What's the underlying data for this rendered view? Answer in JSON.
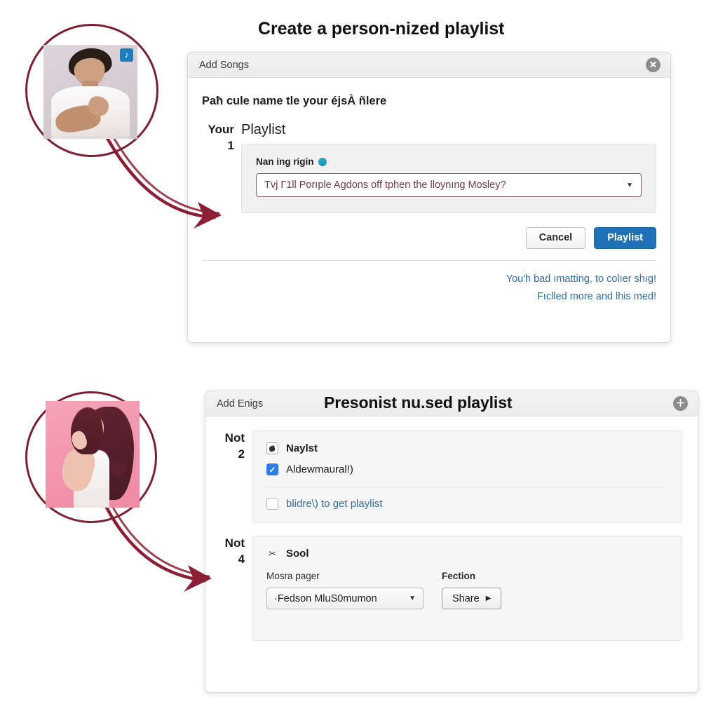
{
  "headings": {
    "top": "Create a person-nized playlist",
    "bottom": "Presonist nu.sed playlist"
  },
  "callouts": [
    {
      "name": "photo-man",
      "badge": "♪"
    },
    {
      "name": "photo-woman",
      "badge": ""
    }
  ],
  "top_dialog": {
    "titlebar": {
      "title": "Add Songs",
      "close_icon": "close-icon",
      "close_glyph": "✕"
    },
    "prompt": "Paħ cule name tle your éjsÀ ñlere",
    "step_tag": {
      "label": "Your",
      "number": "1"
    },
    "section_title": "Playlist",
    "field": {
      "label": "Nan ing rigin",
      "info_icon": "info-icon",
      "selected_value": "Tvј Г1ll Porıple Agdons off tphen the lloynıng Mosley?",
      "caret_glyph": "▼"
    },
    "buttons": {
      "cancel": "Cancel",
      "primary": "Playlist"
    },
    "footer_links": [
      "You'h bad ımatting, to colıer shıɡ!",
      "Fıсlled more and lhis med!"
    ]
  },
  "bottom_panel": {
    "titlebar": {
      "title": "Add Enigs",
      "add_icon": "plus-icon",
      "add_glyph": "＋"
    },
    "cards": [
      {
        "step_tag": {
          "label": "Not",
          "number": "2"
        },
        "options": [
          {
            "icon": "checkbox-marked-icon",
            "state": "marked",
            "text": "Νaylst",
            "style": "strong"
          },
          {
            "icon": "checkbox-checked-icon",
            "state": "checked",
            "check_glyph": "✓",
            "text": "Aldewmaural!)",
            "style": "normal"
          }
        ],
        "divider": true,
        "footer_option": {
          "icon": "checkbox-empty-icon",
          "state": "empty",
          "text": "blidre\\) to get playlist",
          "style": "link"
        }
      },
      {
        "step_tag": {
          "label": "Not",
          "number": "4"
        },
        "header": {
          "icon": "scissors-icon",
          "glyph": "✂",
          "text": "Sool"
        },
        "controls": [
          {
            "name": "page-select",
            "label": "Mosra pager",
            "label_bold": false,
            "kind": "select",
            "value": "·Fedson MluS0mumon",
            "caret_glyph": "▼"
          },
          {
            "name": "share-button",
            "label": "Fection",
            "label_bold": true,
            "kind": "button",
            "value": "Share",
            "caret_glyph": "▶"
          }
        ]
      }
    ]
  },
  "colors": {
    "accent_primary": "#1f72b8",
    "accent_link": "#2d6fa8",
    "callout_ring": "#7d1f32",
    "arrow": "#8b1f35",
    "select_border": "#8d5f68",
    "select_text": "#6d3b4b",
    "checkbox_checked": "#2f7ceb",
    "info_dot": "#23a3c4"
  }
}
